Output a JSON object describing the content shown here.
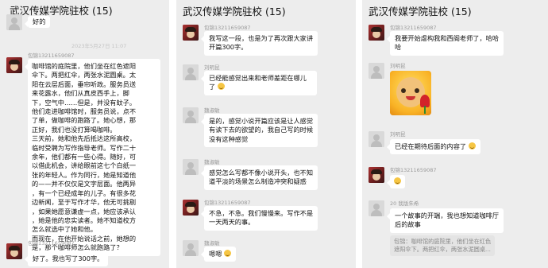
{
  "panels": [
    {
      "title": "武汉传媒学院驻校 (15)",
      "top_bubble": "好的",
      "timestamp": "2023年5月27日 11:07",
      "msg1": {
        "sender": "包锦13211659087",
        "lines": [
          "咖啡馆的庭院里，他们坐在红色遮阳",
          "伞下。两把红伞，两张水泥圆桌。太",
          "阳在云层后面，垂帘听政。服务员送",
          "来花露水，他们从真皮西手上，脚",
          "下，空气中……但是，并没有蚊子。",
          "他们走进咖啡馆时，服务员说，点不",
          "了单，做咖啡的跑路了。她心想，那",
          "正好，我们也没打算喝咖啡。",
          "三天前，她和他先后抵达这所高校，",
          "临时受聘为写作指导老师。写作二十",
          "余年，他们都有一些心得。随好，可",
          "以借此机会，讲给眼前这七个白纸一",
          "张的年轻人。作为同行，她是知道他",
          "的——并不仅仅是文字层面。他两异",
          "，有一个已经成年的儿子。有很多花",
          "边新闻，至于写作才华，他无可挑剔",
          "，如果她愿意谦虚一点，她应该承认",
          "，她是他的忠实读者。她不知道校方",
          "怎么就选中了她和他。",
          "而现在，在他开始说话之前，她想的",
          "是，那个咖啡师怎么就跑路了？"
        ]
      },
      "msg2": {
        "sender": "包锦13211659087",
        "text": "好了。我也写了300字。"
      }
    },
    {
      "title": "武汉传媒学院驻校 (15)",
      "msg1": {
        "sender": "包锦13211659087",
        "lines": [
          "我写这一段，也是为了再次跟大家讲",
          "开篇300字。"
        ]
      },
      "msg2": {
        "sender": "刘明昆",
        "text": "已经能感觉出来和老师差距在哪儿了"
      },
      "msg3": {
        "sender": "魏淑敏",
        "lines": [
          "是的，感觉小说开篇应该是让人感觉",
          "有读下去的欲望的，我自己写的时候",
          "没有这种感觉"
        ]
      },
      "msg4": {
        "sender": "魏淑敏",
        "lines": [
          "感觉怎么写都不像小说开头，也不知",
          "道平淡的场景怎么制造冲突和疑惑"
        ]
      },
      "msg5": {
        "sender": "包锦13211659087",
        "lines": [
          "不急，不急。我们慢慢来。写作不是",
          "一天两天的事。"
        ]
      },
      "msg6": {
        "sender": "魏淑敏",
        "text": "嗯嗯"
      }
    },
    {
      "title": "武汉传媒学院驻校 (15)",
      "msg1": {
        "sender": "包锦13211659087",
        "lines": [
          "我要开始虐构我和西阁老师了，哈哈",
          "哈"
        ]
      },
      "msg2": {
        "sender": "刘明昆"
      },
      "msg3": {
        "sender": "刘明昆",
        "text": "已经在期待后面的内容了"
      },
      "msg4": {
        "sender": "包锦13211659087"
      },
      "msg5": {
        "sender": "20 我版朱希",
        "lines": [
          "一个故事的开端，我也想知道咖啡厅",
          "后的故事"
        ]
      },
      "quote": {
        "lines": [
          "包锦：咖啡馆的庭院里，他们坐在红色",
          "遮阳伞下。两把红伞，两张水泥圆桌..."
        ]
      }
    }
  ],
  "colors": {
    "bg": "#ededed",
    "bubble": "#ffffff",
    "text": "#111111",
    "meta": "#9a9a9a"
  },
  "icons": [
    "smile-emoji-icon",
    "thinking-emoji-icon",
    "sticker-image-icon",
    "avatar-icon"
  ]
}
